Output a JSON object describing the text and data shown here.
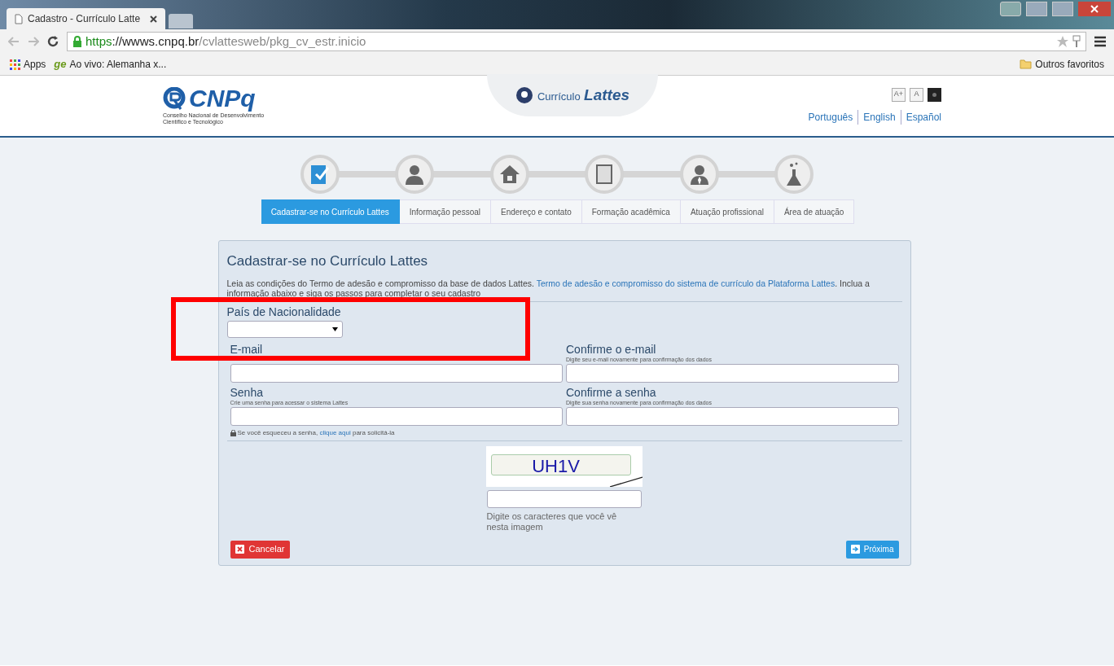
{
  "browser": {
    "tab_title": "Cadastro - Currículo Latte",
    "url": {
      "scheme": "https",
      "host": "://wwws.cnpq.br",
      "path": "/cvlattesweb/pkg_cv_estr.inicio"
    },
    "bookmarks": [
      {
        "kind": "apps",
        "label": "Apps"
      },
      {
        "kind": "ge",
        "badge": "ge",
        "label": "Ao vivo: Alemanha x..."
      }
    ],
    "other_bookmarks": "Outros favoritos"
  },
  "header": {
    "logo": "CNPq",
    "logo_caption": [
      "Conselho Nacional de Desenvolvimento",
      "Científico e Tecnológico"
    ],
    "product": [
      "Currículo",
      "Lattes"
    ],
    "font_buttons": [
      "A+",
      "A"
    ],
    "languages": [
      "Português",
      "English",
      "Español"
    ]
  },
  "steps": [
    {
      "kind": "register",
      "label": "Cadastrar-se no Currículo Lattes",
      "selected": true
    },
    {
      "kind": "person",
      "label": "Informação pessoal",
      "selected": false
    },
    {
      "kind": "house",
      "label": "Endereço e contato",
      "selected": false
    },
    {
      "kind": "book",
      "label": "Formação acadêmica",
      "selected": false
    },
    {
      "kind": "worker",
      "label": "Atuação profissional",
      "selected": false
    },
    {
      "kind": "flask",
      "label": "Área de atuação",
      "selected": false
    }
  ],
  "form": {
    "title": "Cadastrar-se no Currículo Lattes",
    "intro": "Leia as condições do Termo de adesão e compromisso da base de dados Lattes. ",
    "intro_link": "Termo de adesão e compromisso do sistema de currículo da Plataforma Lattes",
    "intro_end": ". Inclua a informação abaixo e siga os passos para completar o seu cadastro",
    "country_label": "País de Nacionalidade",
    "fields": [
      {
        "label": "E-mail"
      },
      {
        "label": "Confirme o e-mail",
        "hint": "Digite seu e-mail novamente para confirmação dos dados"
      },
      {
        "label": "Senha",
        "hint": "Crie uma senha para acessar o sistema Lattes"
      },
      {
        "label": "Confirme a senha",
        "hint": "Digite sua senha novamente para confirmação dos dados"
      }
    ],
    "forgot": [
      "Se você esqueceu a senha, ",
      "clique aqui",
      " para solicitá-la"
    ],
    "captcha": "UH1V",
    "captcha_hint": "Digite os caracteres que você vê nesta imagem",
    "cancel": "Cancelar",
    "next": "Próxima"
  }
}
